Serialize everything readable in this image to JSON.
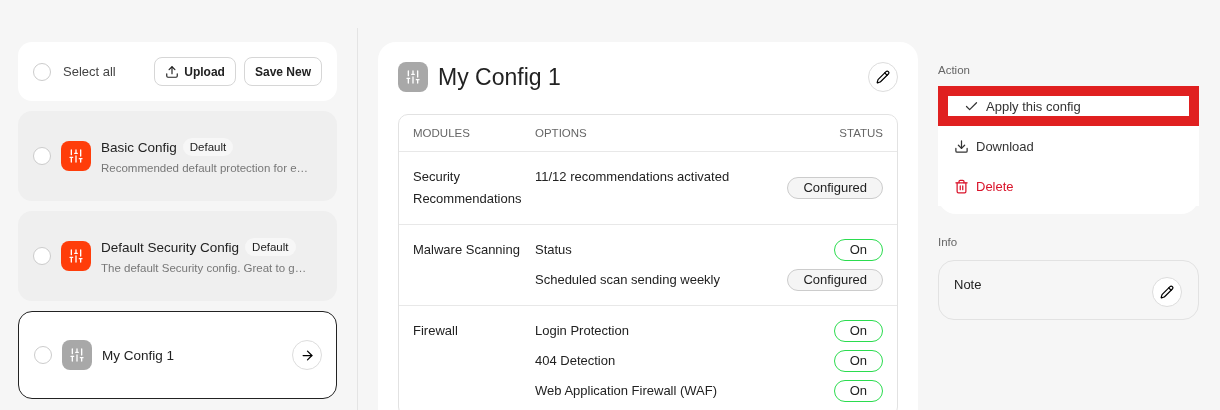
{
  "sidebar": {
    "select_all": {
      "label": "Select all",
      "checked": false
    },
    "buttons": [
      {
        "label": "Upload",
        "kind": "upload"
      },
      {
        "label": "Save New",
        "kind": "plain"
      }
    ],
    "configs": [
      {
        "name": "Basic Config",
        "badge": "Default",
        "description": "Recommended default protection for e…",
        "checked": false,
        "selected": false,
        "color": "#ff3d0a"
      },
      {
        "name": "Default Security Config",
        "badge": "Default",
        "description": "The default Security config. Great to g…",
        "checked": false,
        "selected": false,
        "color": "#ff3d0a"
      },
      {
        "name": "My Config 1",
        "checked": false,
        "selected": true,
        "color": "#a8a8a8"
      }
    ]
  },
  "detail": {
    "title": "My Config 1",
    "color": "#a8a8a8",
    "columns": [
      "MODULES",
      "OPTIONS",
      "STATUS"
    ],
    "modules": [
      {
        "name": "Security Recommendations",
        "options": [
          {
            "label": "11/12 recommendations activated",
            "status": "Configured",
            "kind": "configured"
          }
        ]
      },
      {
        "name": "Malware Scanning",
        "options": [
          {
            "label": "Status",
            "status": "On",
            "kind": "on"
          },
          {
            "label": "Scheduled scan sending weekly",
            "status": "Configured",
            "kind": "configured"
          }
        ]
      },
      {
        "name": "Firewall",
        "options": [
          {
            "label": "Login Protection",
            "status": "On",
            "kind": "on"
          },
          {
            "label": "404 Detection",
            "status": "On",
            "kind": "on"
          },
          {
            "label": "Web Application Firewall (WAF)",
            "status": "On",
            "kind": "on"
          }
        ]
      }
    ]
  },
  "actions": {
    "heading": "Action",
    "items": [
      {
        "label": "Apply this config",
        "kind": "apply",
        "highlighted": true
      },
      {
        "label": "Download",
        "kind": "download",
        "highlighted": false
      },
      {
        "label": "Delete",
        "kind": "delete",
        "highlighted": false
      }
    ]
  },
  "info": {
    "heading": "Info",
    "note": "Note"
  }
}
